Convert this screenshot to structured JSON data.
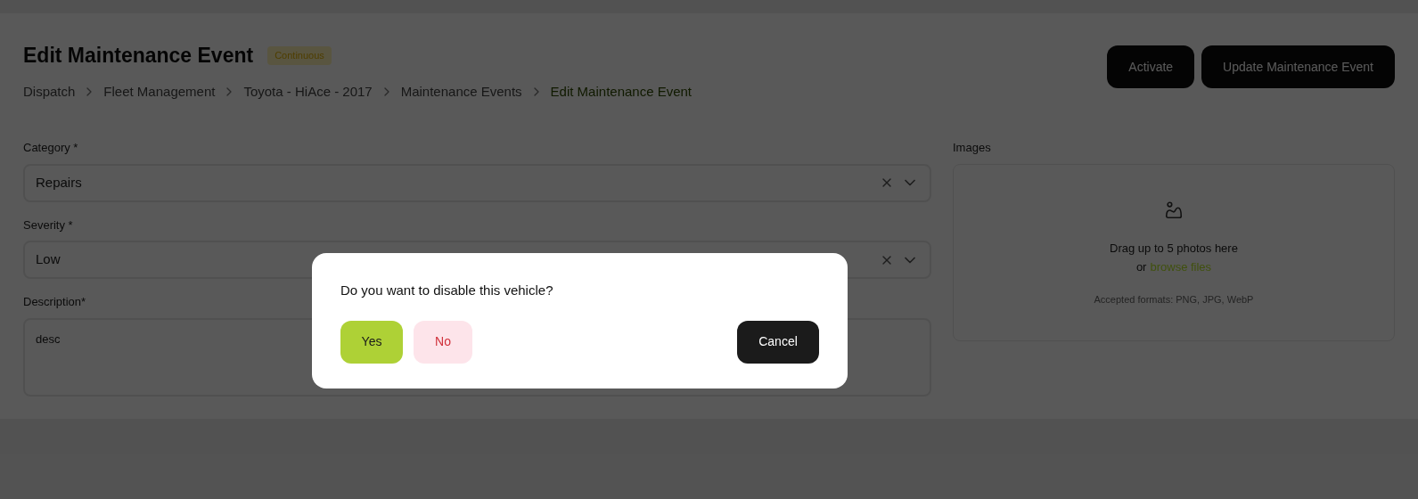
{
  "page": {
    "title": "Edit Maintenance Event",
    "badge": "Continuous",
    "breadcrumbs": [
      {
        "label": "Dispatch",
        "selected": false
      },
      {
        "label": "Fleet Management",
        "selected": false
      },
      {
        "label": "Toyota - HiAce - 2017",
        "selected": false
      },
      {
        "label": "Maintenance Events",
        "selected": false
      },
      {
        "label": "Edit Maintenance Event",
        "selected": true
      }
    ],
    "actions": [
      "Activate",
      "Update Maintenance Event"
    ]
  },
  "form": {
    "fields": [
      {
        "kind": "select",
        "label": "Category *",
        "value": "Repairs"
      },
      {
        "kind": "select",
        "label": "Severity *",
        "value": "Low"
      },
      {
        "kind": "textarea",
        "label": "Description*",
        "value": "desc"
      }
    ],
    "images": {
      "label": "Images",
      "prompt": "Drag up to 5 photos here",
      "or": "or",
      "link": "browse files",
      "formats": "Accepted formats: PNG, JPG, WebP"
    }
  },
  "dialog": {
    "message": "Do you want to disable this vehicle?",
    "buttons": [
      {
        "kind": "yes",
        "label": "Yes"
      },
      {
        "kind": "no",
        "label": "No"
      },
      {
        "kind": "cancel",
        "label": "Cancel"
      }
    ]
  }
}
